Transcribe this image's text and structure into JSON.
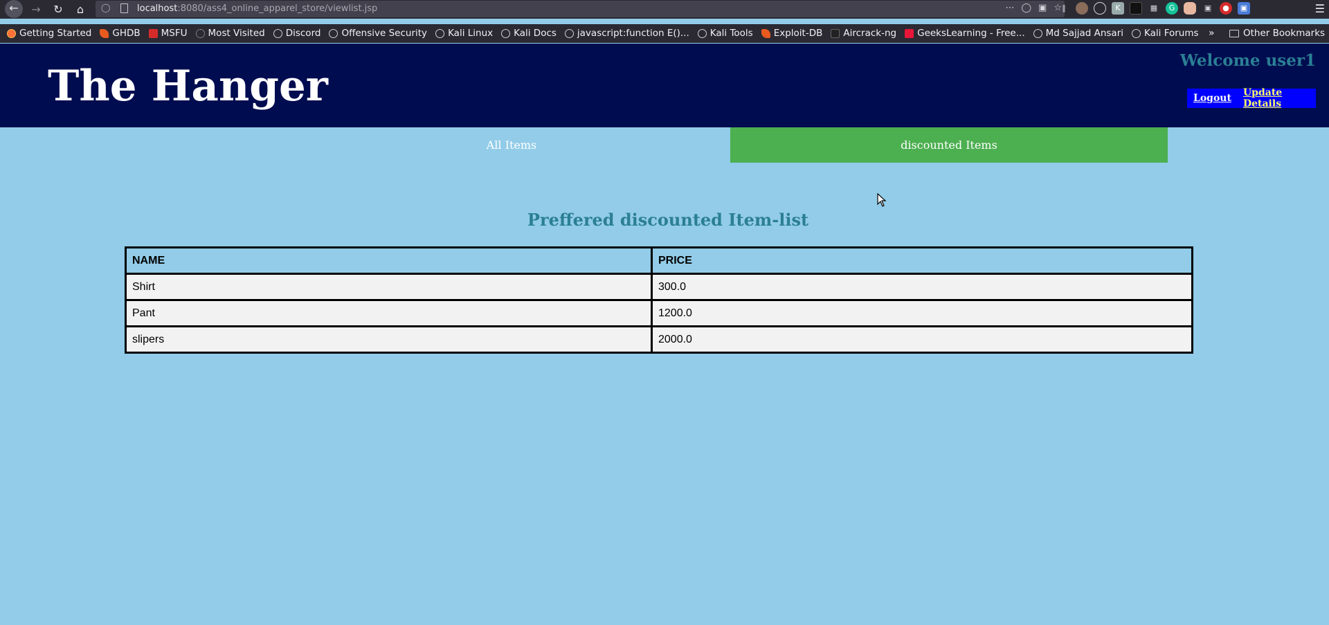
{
  "browser": {
    "url_host": "localhost",
    "url_path": ":8080/ass4_online_apparel_store/viewlist.jsp",
    "bookmarks": [
      {
        "label": "Getting Started",
        "icon": "firefox-icon"
      },
      {
        "label": "GHDB",
        "icon": "offsec-icon"
      },
      {
        "label": "MSFU",
        "icon": "msfu-icon"
      },
      {
        "label": "Most Visited",
        "icon": "gear-icon"
      },
      {
        "label": "Discord",
        "icon": "globe-icon"
      },
      {
        "label": "Offensive Security",
        "icon": "globe-icon"
      },
      {
        "label": "Kali Linux",
        "icon": "globe-icon"
      },
      {
        "label": "Kali Docs",
        "icon": "globe-icon"
      },
      {
        "label": "javascript:function E()...",
        "icon": "globe-icon"
      },
      {
        "label": "Kali Tools",
        "icon": "globe-icon"
      },
      {
        "label": "Exploit-DB",
        "icon": "offsec-icon"
      },
      {
        "label": "Aircrack-ng",
        "icon": "aircrack-icon"
      },
      {
        "label": "GeeksLearning - Free...",
        "icon": "geekslearning-icon"
      },
      {
        "label": "Md Sajjad Ansari",
        "icon": "copyright-icon"
      },
      {
        "label": "Kali Forums",
        "icon": "globe-icon"
      }
    ],
    "other_bookmarks": "Other Bookmarks"
  },
  "header": {
    "title": "The Hanger",
    "welcome": "Welcome user1",
    "logout_label": "Logout",
    "update_label": "Update Details"
  },
  "nav": {
    "all_items": "All Items",
    "discounted_items": "discounted Items"
  },
  "main": {
    "heading": "Preffered discounted Item-list",
    "columns": [
      "NAME",
      "PRICE"
    ],
    "rows": [
      [
        "Shirt",
        "300.0"
      ],
      [
        "Pant",
        "1200.0"
      ],
      [
        "slipers",
        "2000.0"
      ]
    ]
  },
  "colors": {
    "header_bg": "#000c50",
    "page_bg": "#92cce8",
    "active_tab": "#4caf50",
    "accent_text": "#2b7f94",
    "account_box": "#0000ff"
  }
}
